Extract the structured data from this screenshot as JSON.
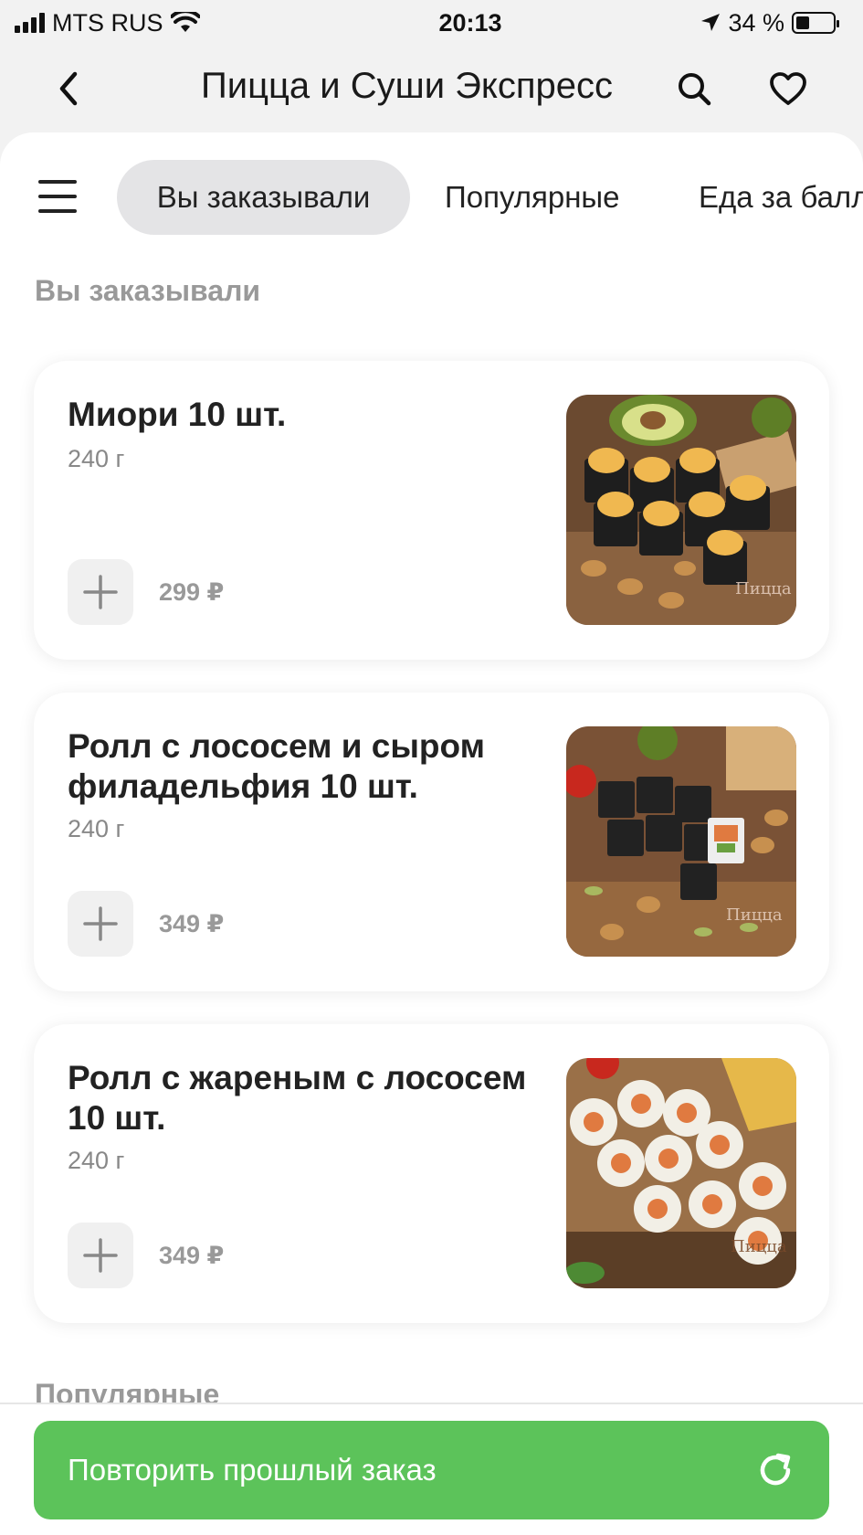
{
  "status_bar": {
    "carrier": "MTS RUS",
    "time": "20:13",
    "battery": "34 %",
    "battery_level": 0.34
  },
  "header": {
    "title": "Пицца и Суши Экспресс",
    "back_icon": "chevron-left-icon",
    "search_icon": "search-icon",
    "favorite_icon": "heart-icon"
  },
  "tabs": [
    {
      "label": "Вы заказывали",
      "active": true
    },
    {
      "label": "Популярные",
      "active": false
    },
    {
      "label": "Еда за балл",
      "active": false
    }
  ],
  "sections": {
    "ordered": "Вы заказывали",
    "popular": "Популярные"
  },
  "products": [
    {
      "name": "Миори 10 шт.",
      "weight": "240 г",
      "price": "299 ₽",
      "image_watermark": "Пицца"
    },
    {
      "name": "Ролл с лососем и сыром филадельфия 10 шт.",
      "weight": "240 г",
      "price": "349 ₽",
      "image_watermark": "Пицца"
    },
    {
      "name": "Ролл с жареным с лососем 10 шт.",
      "weight": "240 г",
      "price": "349 ₽",
      "image_watermark": "Пицца"
    }
  ],
  "bottom": {
    "repeat_label": "Повторить прошлый заказ",
    "repeat_icon": "refresh-icon"
  },
  "colors": {
    "accent_green": "#5cc35a",
    "active_tab_bg": "#e4e4e6",
    "muted_text": "#999999"
  }
}
